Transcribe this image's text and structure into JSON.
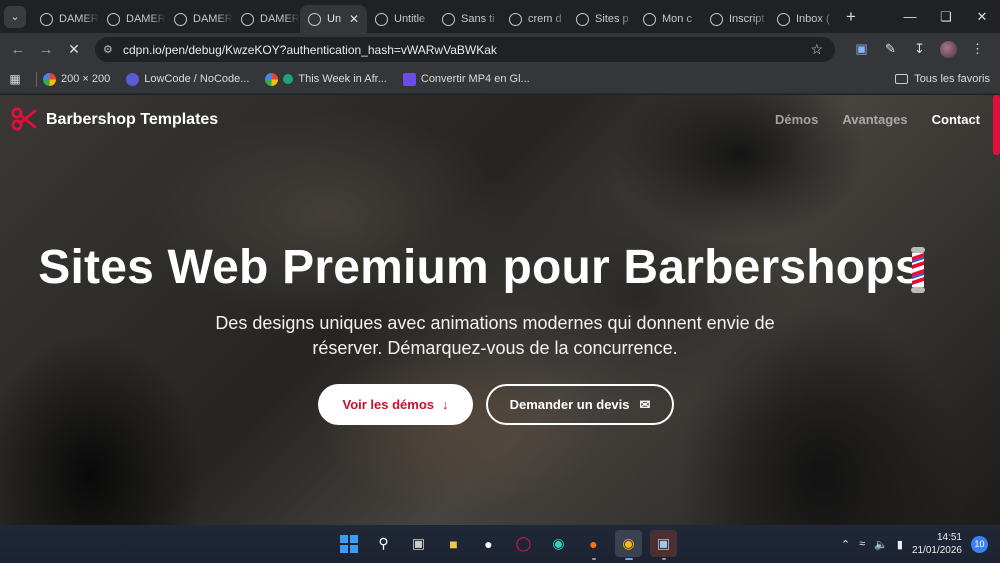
{
  "browser": {
    "tabs": [
      {
        "label": "DAMER",
        "icon": "chatgpt-icon"
      },
      {
        "label": "DAMER",
        "icon": "chatgpt-icon"
      },
      {
        "label": "DAMER",
        "icon": "chatgpt-icon"
      },
      {
        "label": "DAMER",
        "icon": "chatgpt-icon"
      },
      {
        "label": "Un",
        "icon": "chatgpt-icon",
        "active": true
      },
      {
        "label": "Untitle",
        "icon": "chatgpt-icon"
      },
      {
        "label": "Sans ti",
        "icon": "chatgpt-icon"
      },
      {
        "label": "crem d",
        "icon": "yahoo-icon"
      },
      {
        "label": "Sites p",
        "icon": "openai-icon"
      },
      {
        "label": "Mon c",
        "icon": "app-icon"
      },
      {
        "label": "Inscript",
        "icon": "c-icon"
      },
      {
        "label": "Inbox (",
        "icon": "gmail-icon"
      }
    ],
    "url": "cdpn.io/pen/debug/KwzeKOY?authentication_hash=vWARwVaBWKak",
    "bookmarks": [
      {
        "label": "200 × 200",
        "icon": "google-icon"
      },
      {
        "label": "LowCode / NoCode...",
        "icon": "lowcode-icon"
      },
      {
        "label": "This Week in Afr...",
        "icon": "google-icon"
      },
      {
        "label": "Convertir MP4 en Gl...",
        "icon": "convert-icon"
      }
    ],
    "all_bookmarks": "Tous les favoris"
  },
  "site": {
    "brand": "Barbershop Templates",
    "nav": [
      "Démos",
      "Avantages",
      "Contact"
    ],
    "hero_title": "Sites Web Premium pour Barbershops",
    "hero_emoji": "barber-pole",
    "hero_subtitle": "Des designs uniques avec animations modernes qui donnent envie de réserver. Démarquez-vous de la concurrence.",
    "cta_primary": "Voir les démos",
    "cta_secondary": "Demander un devis",
    "colors": {
      "accent": "#c8102e",
      "text": "#ffffff"
    }
  },
  "taskbar": {
    "time": "14:51",
    "date": "21/01/2026",
    "notifications": "10"
  }
}
